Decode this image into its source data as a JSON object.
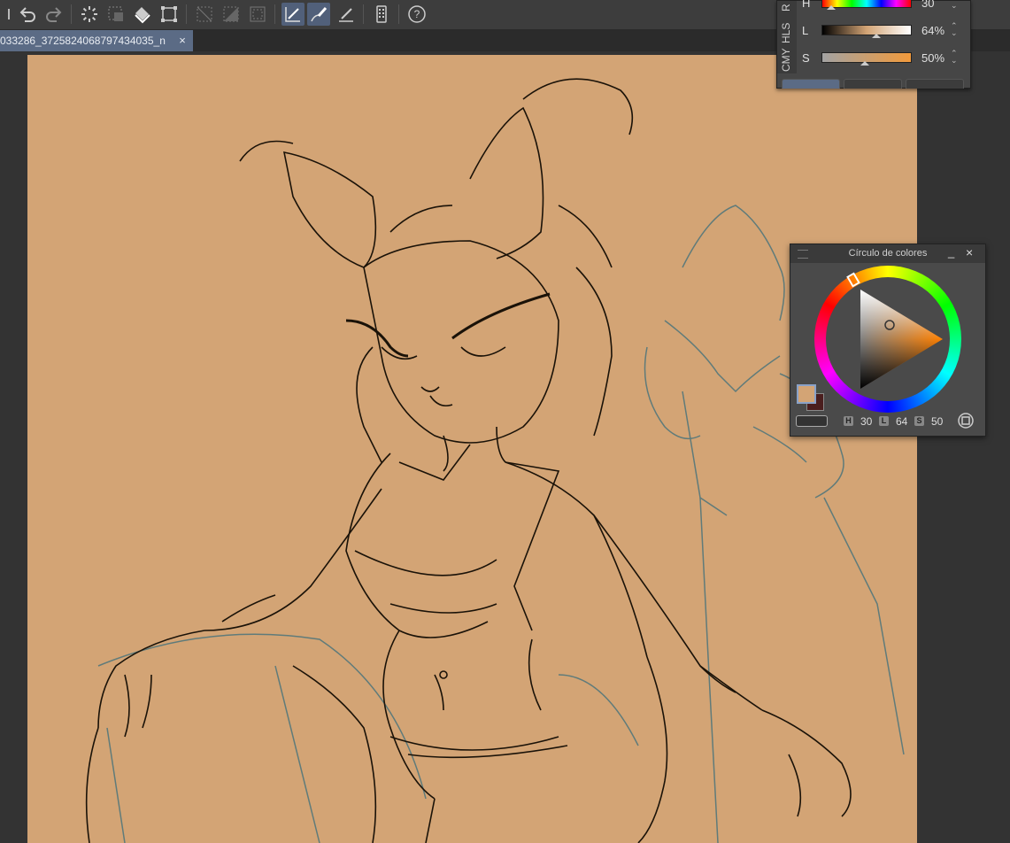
{
  "document": {
    "tab_title": "033286_3725824068797434035_n",
    "close_glyph": "×"
  },
  "toolbar": {
    "tools": [
      "undo-icon",
      "redo-icon",
      "loading-icon",
      "select-all-icon",
      "fill-icon",
      "transform-icon",
      "clear-selection-icon",
      "invert-selection-icon",
      "show-selection-icon",
      "pen-tool-icon",
      "brush-tool-icon",
      "pencil-tool-icon",
      "smartphone-icon",
      "help-icon"
    ]
  },
  "color_slider": {
    "vertical_tabs": [
      "CMY",
      "HLS",
      "R"
    ],
    "rows": [
      {
        "label": "H",
        "value": "30"
      },
      {
        "label": "L",
        "value": "64%"
      },
      {
        "label": "S",
        "value": "50%"
      }
    ]
  },
  "color_wheel": {
    "title": "Círculo de colores",
    "minimize_glyph": "_",
    "close_glyph": "×",
    "h_badge": "H",
    "h_value": "30",
    "l_badge": "L",
    "l_value": "64",
    "s_badge": "S",
    "s_value": "50",
    "main_color": "#d3a475",
    "sub_color": "#4a1e1e"
  }
}
